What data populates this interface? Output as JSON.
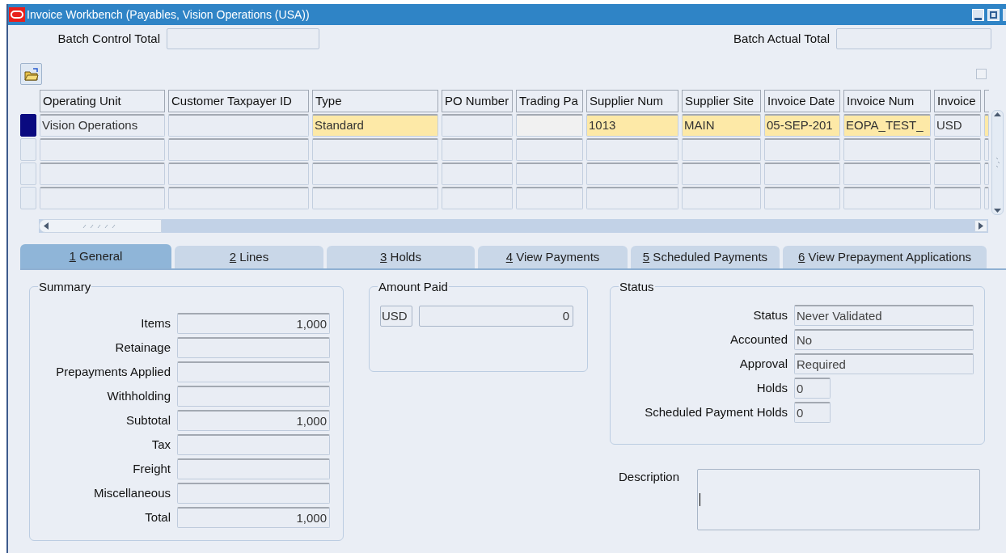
{
  "window": {
    "title": "Invoice Workbench (Payables, Vision Operations (USA))"
  },
  "batch_control_total": {
    "label": "Batch Control Total"
  },
  "batch_actual_total": {
    "label": "Batch Actual Total"
  },
  "record_checkbox": {
    "checked": false
  },
  "table": {
    "columns": [
      "Operating Unit",
      "Customer Taxpayer ID",
      "Type",
      "PO Number",
      "Trading Pa",
      "Supplier Num",
      "Supplier Site",
      "Invoice Date",
      "Invoice Num",
      "Invoice"
    ],
    "rows": [
      {
        "selected": true,
        "cells": [
          {
            "value": "Vision Operations",
            "required": false
          },
          {
            "required": false
          },
          {
            "value": "Standard",
            "required": true
          },
          {
            "required": false
          },
          {
            "required": false,
            "kind": "light"
          },
          {
            "value": "1013",
            "required": true
          },
          {
            "value": "MAIN",
            "required": true
          },
          {
            "value": "05-SEP-201",
            "required": true
          },
          {
            "value": "EOPA_TEST_",
            "required": true
          },
          {
            "value": "USD",
            "required": false
          },
          {
            "required": true
          }
        ]
      },
      {
        "selected": false
      },
      {
        "selected": false
      },
      {
        "selected": false
      }
    ]
  },
  "tabs": [
    {
      "mnemonic": "1",
      "label": "General",
      "selected": true
    },
    {
      "mnemonic": "2",
      "label": "Lines",
      "selected": false
    },
    {
      "mnemonic": "3",
      "label": "Holds",
      "selected": false
    },
    {
      "mnemonic": "4",
      "label": "View Payments",
      "selected": false
    },
    {
      "mnemonic": "5",
      "label": "Scheduled Payments",
      "selected": false
    },
    {
      "mnemonic": "6",
      "label": "View Prepayment Applications",
      "selected": false
    }
  ],
  "summary": {
    "title": "Summary",
    "fields": [
      {
        "label": "Items",
        "value": "1,000"
      },
      {
        "label": "Retainage"
      },
      {
        "label": "Prepayments Applied"
      },
      {
        "label": "Withholding"
      },
      {
        "label": "Subtotal",
        "value": "1,000"
      },
      {
        "label": "Tax"
      },
      {
        "label": "Freight"
      },
      {
        "label": "Miscellaneous"
      },
      {
        "label": "Total",
        "value": "1,000"
      }
    ]
  },
  "amount_paid": {
    "title": "Amount Paid",
    "currency": "USD",
    "amount": "0"
  },
  "status": {
    "title": "Status",
    "fields": [
      {
        "label": "Status",
        "value": "Never Validated",
        "kind": "wide"
      },
      {
        "label": "Accounted",
        "value": "No",
        "kind": "wide"
      },
      {
        "label": "Approval",
        "value": "Required",
        "kind": "wide"
      },
      {
        "label": "Holds",
        "value": "0",
        "kind": "narrow"
      },
      {
        "label": "Scheduled Payment Holds",
        "value": "0",
        "kind": "narrow"
      }
    ]
  },
  "description": {
    "label": "Description"
  }
}
